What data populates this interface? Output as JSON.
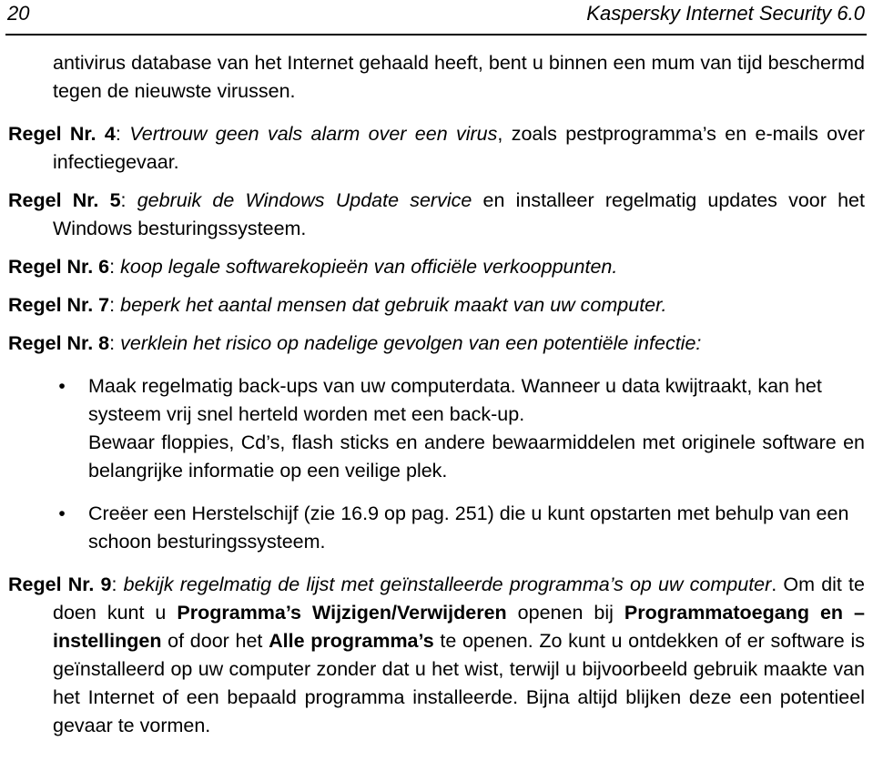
{
  "header": {
    "page_number": "20",
    "document_title": "Kaspersky Internet Security 6.0"
  },
  "content": {
    "intro_paragraph": "antivirus database van het Internet gehaald heeft, bent u binnen een mum van tijd beschermd tegen de nieuwste virussen.",
    "rules": [
      {
        "label": "Regel Nr. 4",
        "colon": ":",
        "italic_text": "Vertrouw geen vals alarm over een virus",
        "rest_text": ", zoals pestprogramma’s en e-mails over infectiegevaar."
      },
      {
        "label": "Regel Nr. 5",
        "colon": ":",
        "italic_text": "gebruik de Windows Update service",
        "rest_text": " en installeer regelmatig updates voor het Windows besturingssysteem."
      },
      {
        "label": "Regel Nr. 6",
        "colon": ":",
        "italic_text": "koop legale softwarekopieën van officiële verkooppunten.",
        "rest_text": ""
      },
      {
        "label": "Regel Nr. 7",
        "colon": ":",
        "italic_text": "beperk het aantal mensen dat gebruik maakt van uw computer.",
        "rest_text": ""
      },
      {
        "label": "Regel Nr. 8",
        "colon": ":",
        "italic_text": "verklein het risico op nadelige gevolgen van een potentiële infectie:",
        "rest_text": ""
      }
    ],
    "bullet_marker": "•",
    "bullets": [
      {
        "text": "Maak regelmatig back-ups van uw computerdata. Wanneer u data kwijtraakt, kan het systeem vrij snel herteld worden met een back-up.",
        "continuation": "Bewaar floppies, Cd’s, flash sticks en andere bewaarmiddelen met originele software en belangrijke informatie op een veilige plek."
      },
      {
        "text": "Creëer een Herstelschijf (zie 16.9 op pag. 251) die u kunt opstarten met behulp van een schoon besturingssysteem.",
        "continuation": ""
      }
    ],
    "rule9": {
      "label": "Regel Nr. 9",
      "colon": ":",
      "italic_1": "bekijk regelmatig de lijst met geïnstalleerde programma’s op uw computer",
      "plain_1": ". Om dit te doen kunt u ",
      "bold_1": "Programma’s Wijzigen/Verwijderen",
      "plain_2": " openen bij ",
      "bold_2": "Programmatoegang en –instellingen",
      "plain_3": " of door het ",
      "bold_3": "Alle programma’s",
      "plain_4": " te openen. Zo kunt u ontdekken of er software is geïnstalleerd op uw computer zonder dat u het wist, terwijl u bijvoorbeeld gebruik maakte van het Internet of een bepaald programma installeerde. Bijna altijd blijken deze een potentieel gevaar te vormen."
    }
  }
}
